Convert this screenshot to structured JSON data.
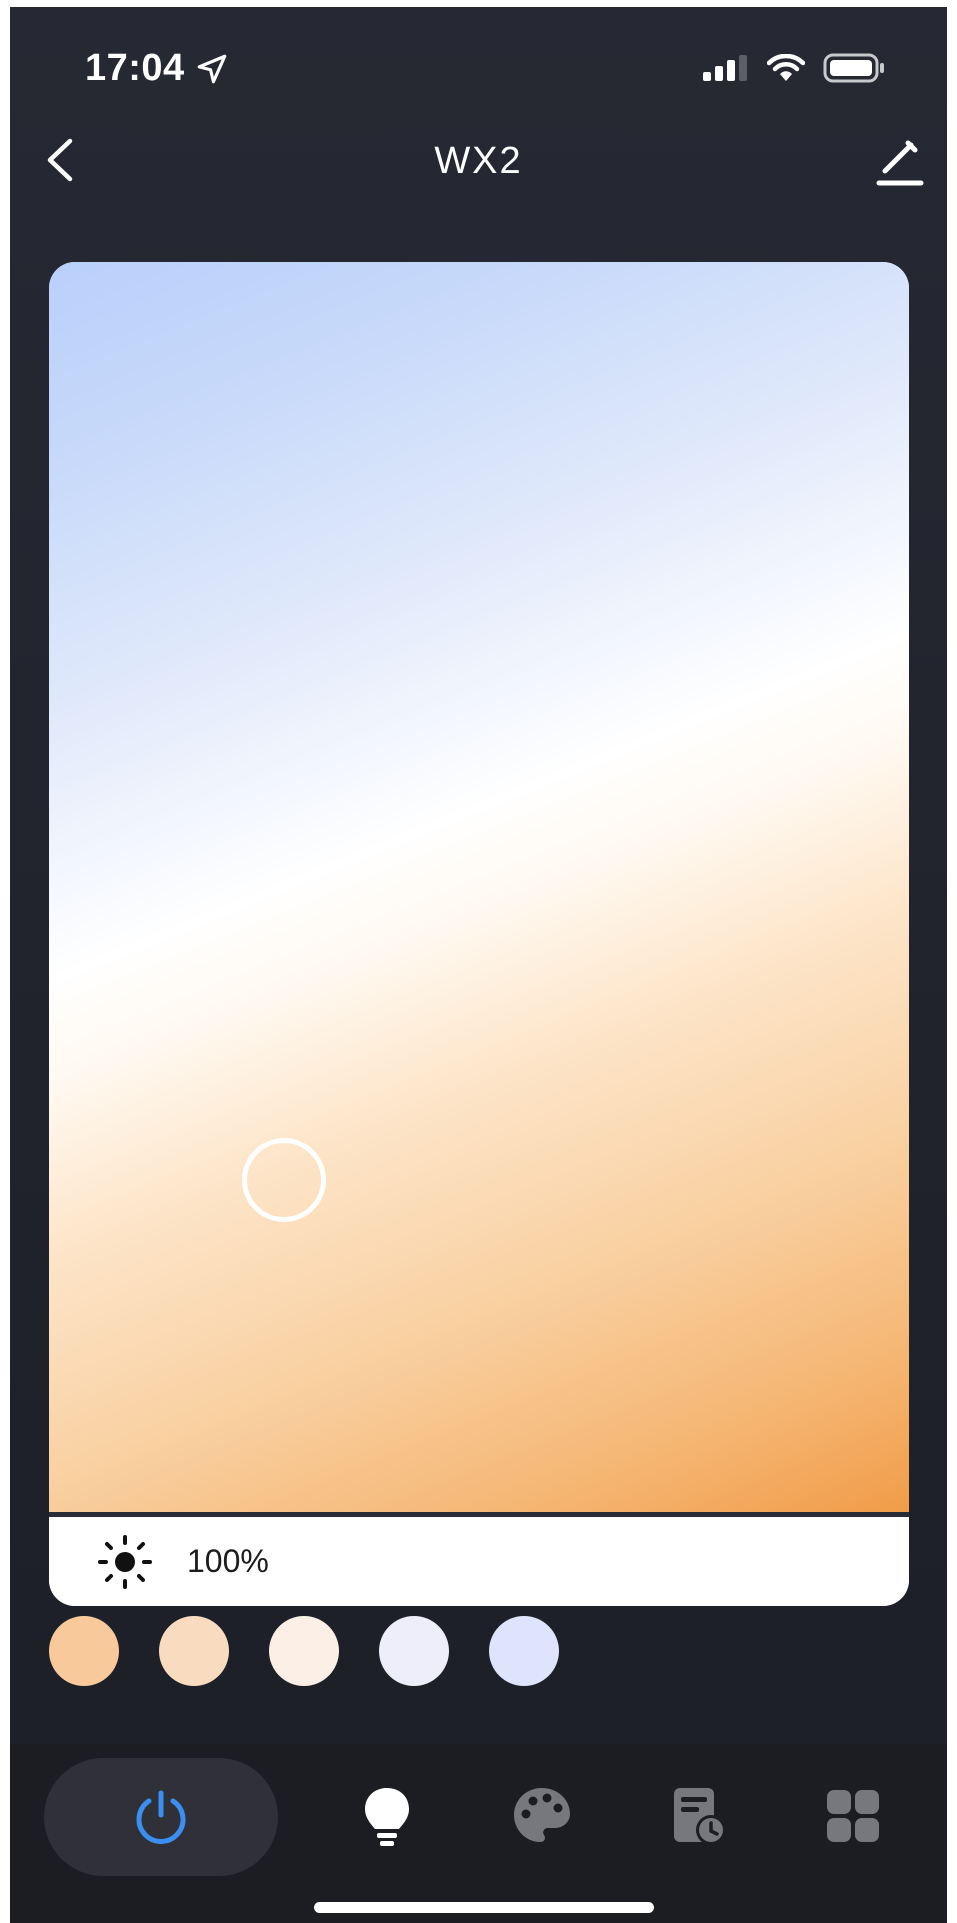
{
  "status_bar": {
    "time": "17:04",
    "location_icon": "location-arrow-icon",
    "signal_icon": "cellular-signal-icon",
    "wifi_icon": "wifi-icon",
    "battery_icon": "battery-icon"
  },
  "nav": {
    "title": "WX2",
    "back_icon": "chevron-left-icon",
    "edit_icon": "pencil-icon"
  },
  "picker": {
    "brightness_value": "100%",
    "brightness_icon": "sun-icon",
    "thumb_color_hint": "#f8d3a8"
  },
  "presets": [
    {
      "color": "#f8c99b"
    },
    {
      "color": "#f9dcc0"
    },
    {
      "color": "#fbefe6"
    },
    {
      "color": "#eeeefb"
    },
    {
      "color": "#dde4fb"
    }
  ],
  "bottom_nav": {
    "active": "power",
    "accent": "#3b8ff0",
    "items": [
      {
        "icon": "power-icon"
      },
      {
        "icon": "lightbulb-icon"
      },
      {
        "icon": "palette-icon"
      },
      {
        "icon": "schedule-icon"
      },
      {
        "icon": "grid-icon"
      }
    ]
  }
}
